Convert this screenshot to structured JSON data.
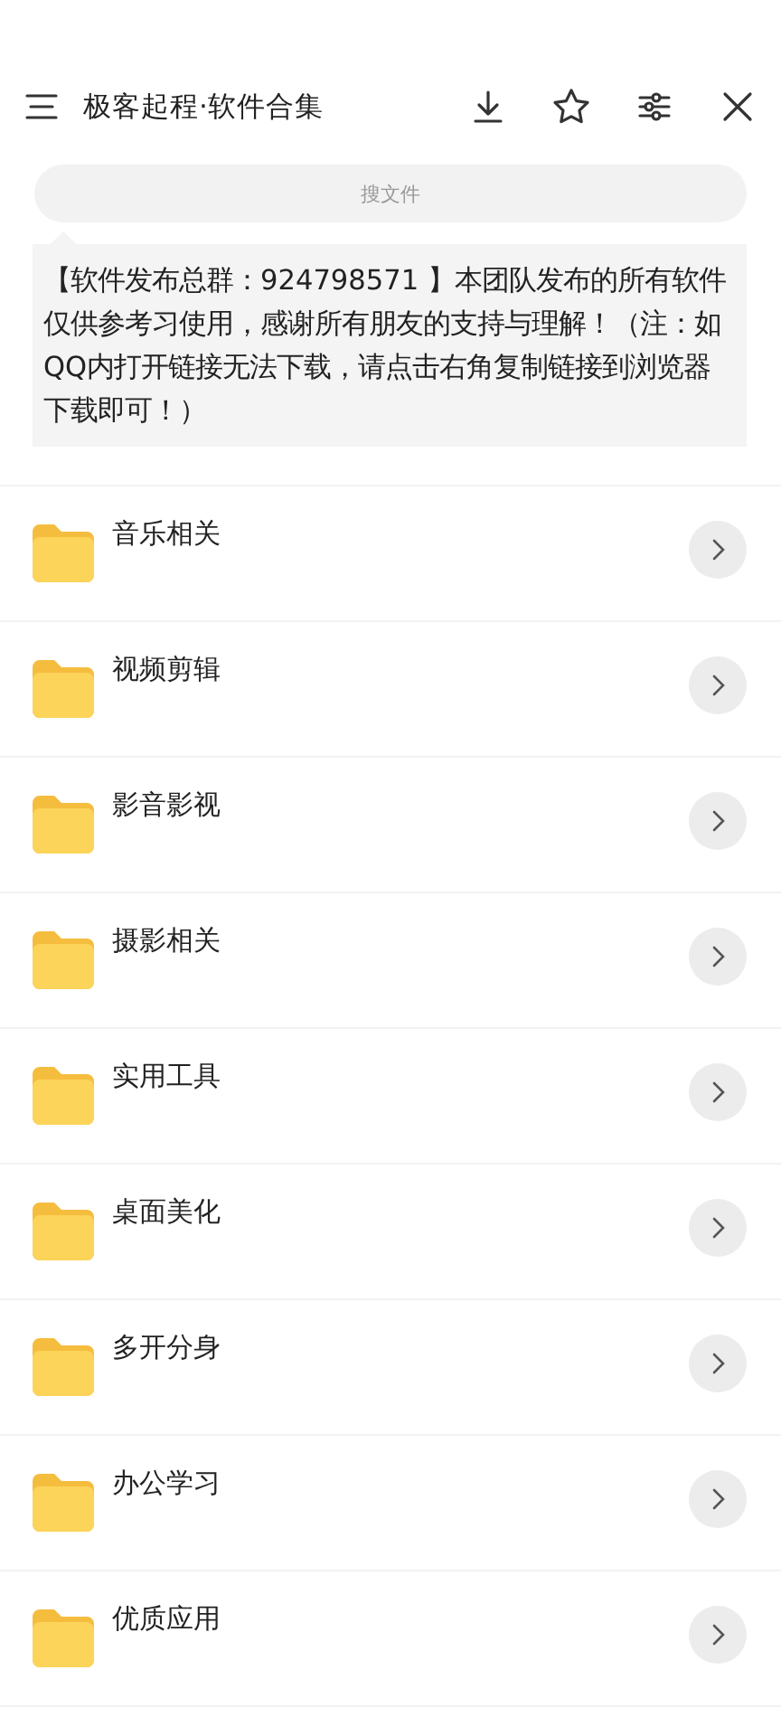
{
  "header": {
    "title": "极客起程·软件合集"
  },
  "search": {
    "placeholder": "搜文件"
  },
  "notice": "【软件发布总群：924798571 】本团队发布的所有软件仅供参考习使用，感谢所有朋友的支持与理解！（注：如QQ内打开链接无法下载，请点击右角复制链接到浏览器下载即可！）",
  "folders": [
    {
      "name": "音乐相关"
    },
    {
      "name": "视频剪辑"
    },
    {
      "name": "影音影视"
    },
    {
      "name": "摄影相关"
    },
    {
      "name": "实用工具"
    },
    {
      "name": "桌面美化"
    },
    {
      "name": "多开分身"
    },
    {
      "name": "办公学习"
    },
    {
      "name": "优质应用"
    }
  ]
}
